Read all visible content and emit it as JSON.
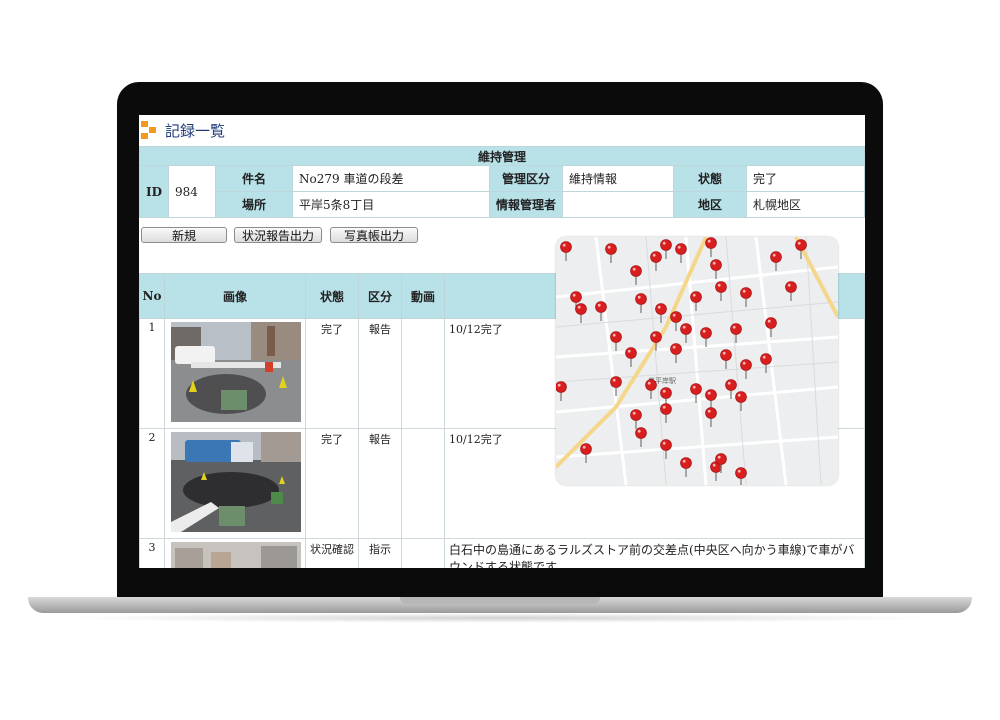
{
  "page": {
    "title": "記録一覧"
  },
  "info": {
    "section_title": "維持管理",
    "id_label": "ID",
    "id_value": "984",
    "subject_label": "件名",
    "subject_value": "No279 車道の段差",
    "mgmt_category_label": "管理区分",
    "mgmt_category_value": "維持情報",
    "status_label": "状態",
    "status_value": "完了",
    "location_label": "場所",
    "location_value": "平岸5条8丁目",
    "info_manager_label": "情報管理者",
    "info_manager_value": "",
    "district_label": "地区",
    "district_value": "札幌地区"
  },
  "buttons": {
    "new": "新規",
    "status_report": "状況報告出力",
    "photo_book": "写真帳出力"
  },
  "records": {
    "headers": {
      "no": "No",
      "image": "画像",
      "status": "状態",
      "category": "区分",
      "video": "動画"
    },
    "rows": [
      {
        "no": "1",
        "status": "完了",
        "category": "報告",
        "video": "",
        "note": "10/12完了"
      },
      {
        "no": "2",
        "status": "完了",
        "category": "報告",
        "video": "",
        "note": "10/12完了"
      },
      {
        "no": "3",
        "status": "状況確認",
        "category": "指示",
        "video": "",
        "note": "白石中の島通にあるラルズストア前の交差点(中央区へ向かう車線)で車がバウンドする状態です。"
      }
    ]
  },
  "map": {
    "station_label": "美平岸駅"
  },
  "colors": {
    "header_bg": "#b8e1e8",
    "title": "#1f3c7a",
    "accent": "#f39a1e",
    "pin": "#d81e1e"
  }
}
